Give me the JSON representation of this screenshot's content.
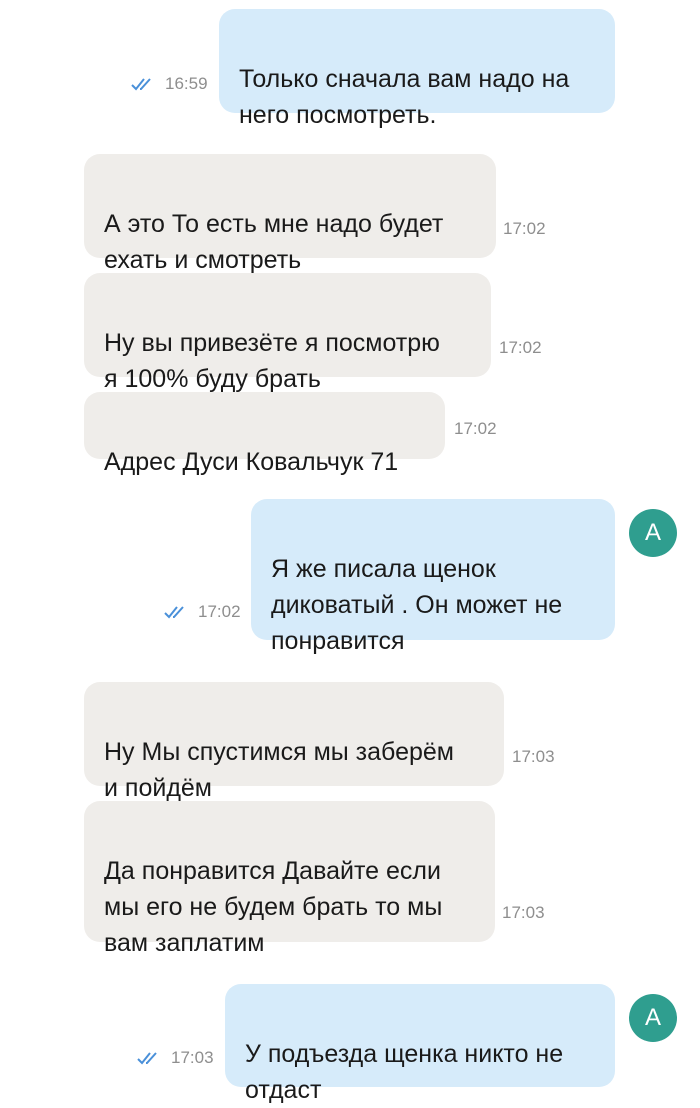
{
  "messages": [
    {
      "direction": "outgoing",
      "text": "Только сначала вам надо на\nнего посмотреть.",
      "time": "16:59",
      "status": "read"
    },
    {
      "direction": "incoming",
      "text": "А это То есть мне надо будет\nехать и смотреть",
      "time": "17:02"
    },
    {
      "direction": "incoming",
      "text": "Ну вы привезёте я посмотрю\nя 100% буду брать",
      "time": "17:02"
    },
    {
      "direction": "incoming",
      "text": "Адрес Дуси Ковальчук 71",
      "time": "17:02"
    },
    {
      "direction": "outgoing",
      "text": "Я же писала щенок\nдиковатый . Он может не\nпонравится",
      "time": "17:02",
      "status": "read",
      "avatar": "A"
    },
    {
      "direction": "incoming",
      "text": "Ну Мы спустимся мы заберём\nи пойдём",
      "time": "17:03"
    },
    {
      "direction": "incoming",
      "text": "Да понравится Давайте если\nмы его не будем брать то мы\nвам заплатим",
      "time": "17:03"
    },
    {
      "direction": "outgoing",
      "text": "У подъезда щенка никто не\nотдаст",
      "time": "17:03",
      "status": "read",
      "avatar": "A"
    }
  ],
  "colors": {
    "outgoing_bubble": "#d6ebfa",
    "incoming_bubble": "#efedea",
    "timestamp": "#8e8e8e",
    "read_check": "#4a90d9",
    "avatar_bg": "#2f9e8f"
  }
}
